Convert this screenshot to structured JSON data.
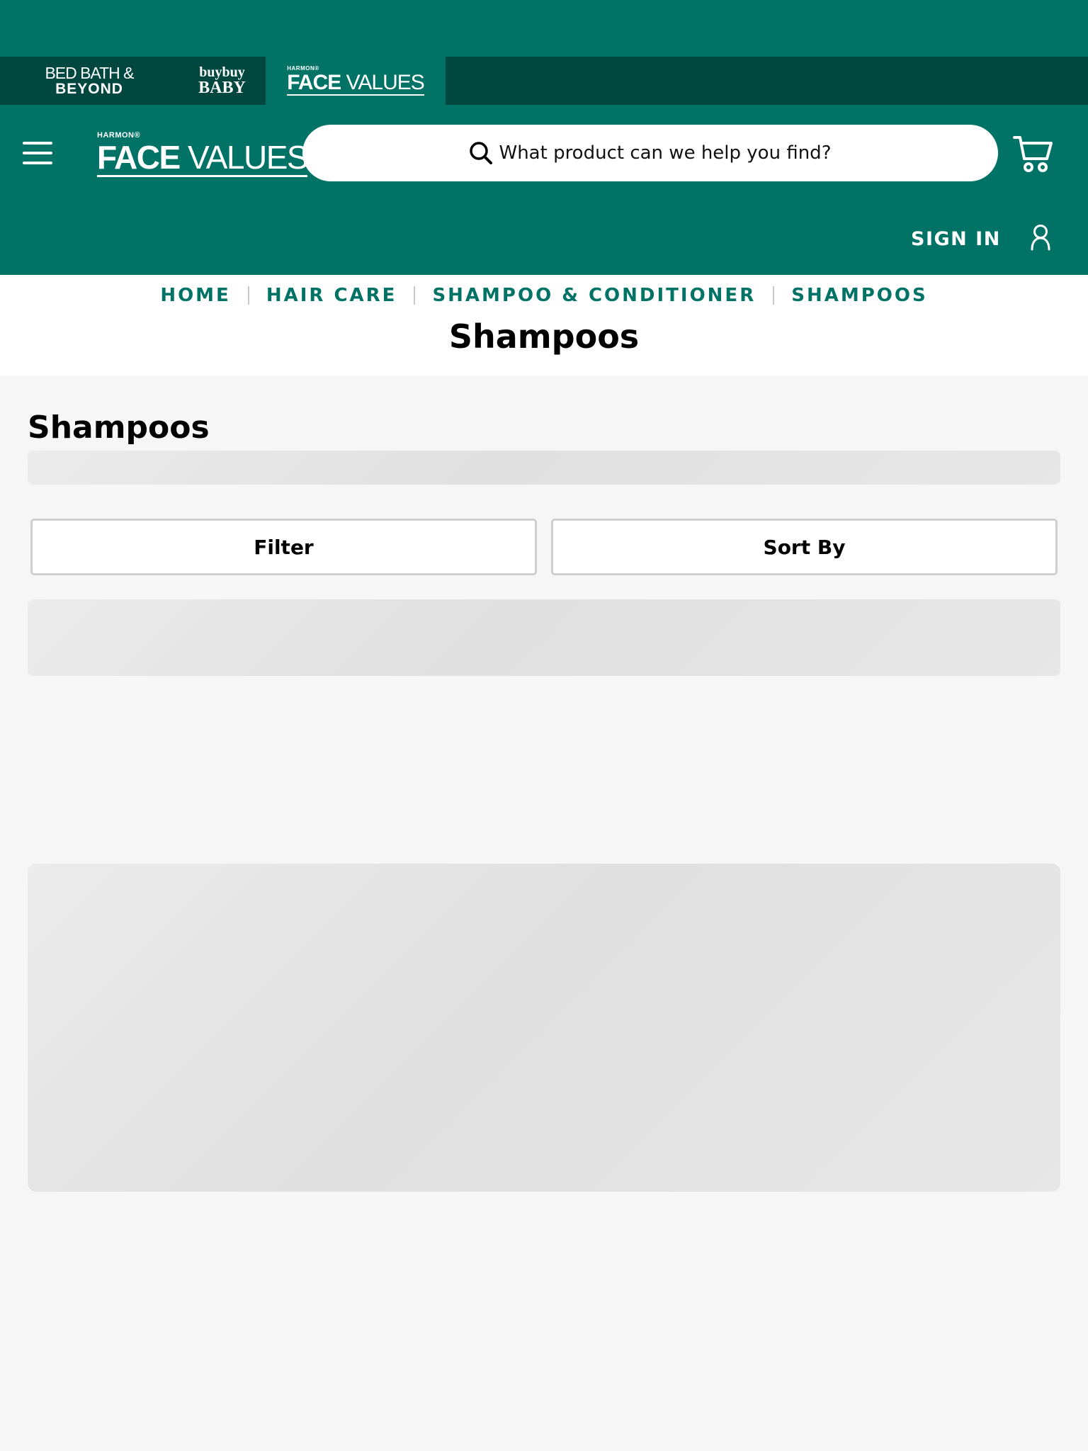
{
  "brand_bar": {
    "bbb_line1": "BED BATH &",
    "bbb_line2": "BEYOND",
    "baby_line1": "buybuy",
    "baby_line2": "BABY",
    "fv_harmon": "HARMON®",
    "fv_face": "FACE",
    "fv_values": " VALUES"
  },
  "header": {
    "logo_harmon": "HARMON®",
    "logo_face": "FACE",
    "logo_values": " VALUES",
    "search_placeholder": "What product can we help you find?",
    "sign_in": "SIGN IN",
    "icons": [
      "menu-icon",
      "search-icon",
      "cart-icon",
      "user-icon"
    ]
  },
  "breadcrumb": [
    "HOME",
    "HAIR CARE",
    "SHAMPOO & CONDITIONER",
    "SHAMPOOS"
  ],
  "page_title": "Shampoos",
  "section_title": "Shampoos",
  "controls": {
    "filter_label": "Filter",
    "sort_label": "Sort By"
  },
  "colors": {
    "brand_green": "#007366",
    "brand_dark_green": "#00473f",
    "skeleton_gray": "#e3e3e3",
    "page_bg": "#f6f6f6"
  }
}
